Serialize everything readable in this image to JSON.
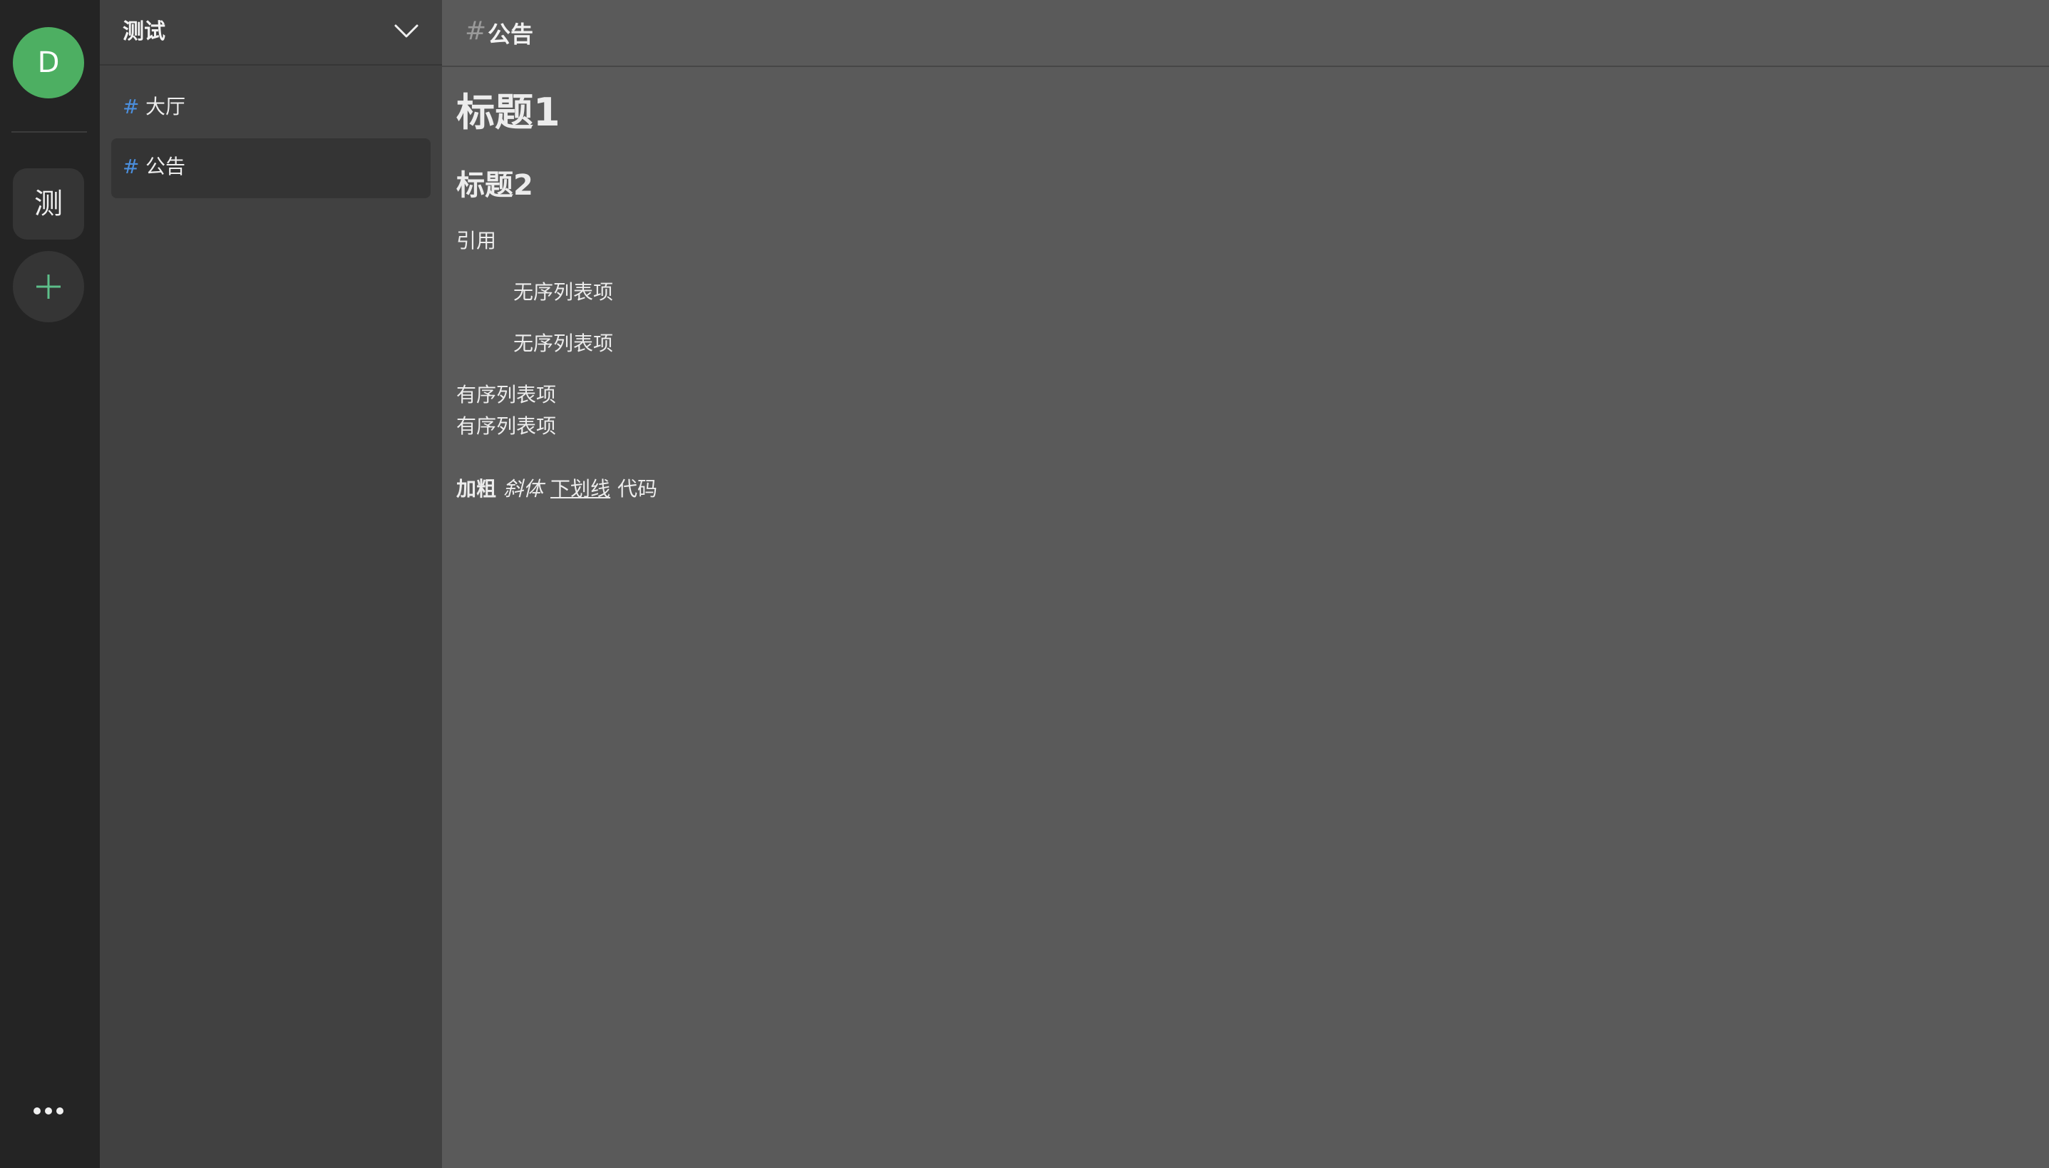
{
  "rail": {
    "avatar_letter": "D",
    "avatar_color": "#4daf62",
    "server_tile_label": "测",
    "add_icon": "plus-icon",
    "more_icon": "ellipsis-icon"
  },
  "sidebar": {
    "server_name": "测试",
    "dropdown_icon": "chevron-down-icon",
    "channels": [
      {
        "hash": "#",
        "label": "大厅",
        "active": false
      },
      {
        "hash": "#",
        "label": "公告",
        "active": true
      }
    ]
  },
  "main": {
    "header": {
      "hash": "#",
      "title": "公告"
    },
    "content": {
      "heading1": "标题1",
      "heading2": "标题2",
      "quote": "引用",
      "unordered": [
        "无序列表项",
        "无序列表项"
      ],
      "ordered": [
        "有序列表项",
        "有序列表项"
      ],
      "formatting": {
        "bold": "加粗",
        "italic": "斜体",
        "underline": "下划线",
        "code": "代码"
      }
    }
  },
  "colors": {
    "rail_bg": "#242424",
    "sidebar_bg": "#414141",
    "main_bg": "#5a5a5a",
    "hash_accent": "#4b8fde",
    "plus_accent": "#5dbf8a"
  }
}
